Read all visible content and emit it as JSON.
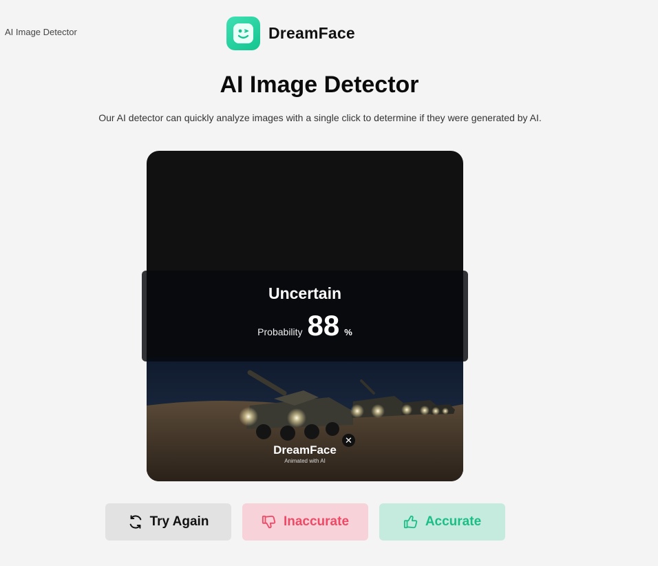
{
  "header": {
    "corner_title": "AI Image Detector",
    "brand_name": "DreamFace"
  },
  "main": {
    "title": "AI Image Detector",
    "subtitle": "Our AI detector can quickly analyze images with a single click to determine if they were generated by AI."
  },
  "result": {
    "status": "Uncertain",
    "probability_label": "Probability",
    "probability_value": "88",
    "probability_unit": "%"
  },
  "watermark": {
    "name": "DreamFace",
    "tagline": "Animated with AI",
    "close_symbol": "✕"
  },
  "actions": {
    "try_again": "Try Again",
    "inaccurate": "Inaccurate",
    "accurate": "Accurate"
  },
  "colors": {
    "brand": "#13c48f",
    "inaccurate_text": "#ee4a67",
    "accurate_text": "#1bbf86"
  },
  "icons": {
    "try_again": "refresh-icon",
    "inaccurate": "thumbs-down-icon",
    "accurate": "thumbs-up-icon"
  }
}
